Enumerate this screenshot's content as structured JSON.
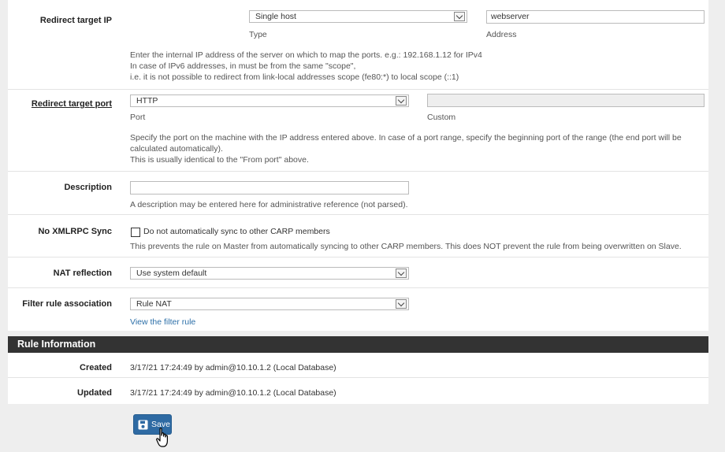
{
  "form": {
    "redirect_ip": {
      "label": "Redirect target IP",
      "type_value": "Single host",
      "type_caption": "Type",
      "address_value": "webserver",
      "address_caption": "Address",
      "help_1": "Enter the internal IP address of the server on which to map the ports. e.g.: 192.168.1.12 for IPv4",
      "help_2": "In case of IPv6 addresses, in must be from the same \"scope\",",
      "help_3": "i.e. it is not possible to redirect from link-local addresses scope (fe80:*) to local scope (::1)"
    },
    "redirect_port": {
      "label": "Redirect target port",
      "port_value": "HTTP",
      "port_caption": "Port",
      "custom_caption": "Custom",
      "help_1": "Specify the port on the machine with the IP address entered above. In case of a port range, specify the beginning port of the range (the end port will be",
      "help_2": "calculated automatically).",
      "help_3": "This is usually identical to the \"From port\" above."
    },
    "description": {
      "label": "Description",
      "value": "",
      "help": "A description may be entered here for administrative reference (not parsed)."
    },
    "no_xmlrpc": {
      "label": "No XMLRPC Sync",
      "checkbox_label": "Do not automatically sync to other CARP members",
      "checked": false,
      "help": "This prevents the rule on Master from automatically syncing to other CARP members. This does NOT prevent the rule from being overwritten on Slave."
    },
    "nat_reflection": {
      "label": "NAT reflection",
      "value": "Use system default"
    },
    "filter_rule": {
      "label": "Filter rule association",
      "value": "Rule NAT",
      "link": "View the filter rule"
    }
  },
  "rule_info": {
    "title": "Rule Information",
    "created_label": "Created",
    "created_value": "3/17/21 17:24:49 by admin@10.10.1.2 (Local Database)",
    "updated_label": "Updated",
    "updated_value": "3/17/21 17:24:49 by admin@10.10.1.2 (Local Database)"
  },
  "actions": {
    "save_label": "Save"
  },
  "colors": {
    "primary": "#2e6aa3",
    "section_header": "#333333",
    "link": "#2c6fa8"
  }
}
